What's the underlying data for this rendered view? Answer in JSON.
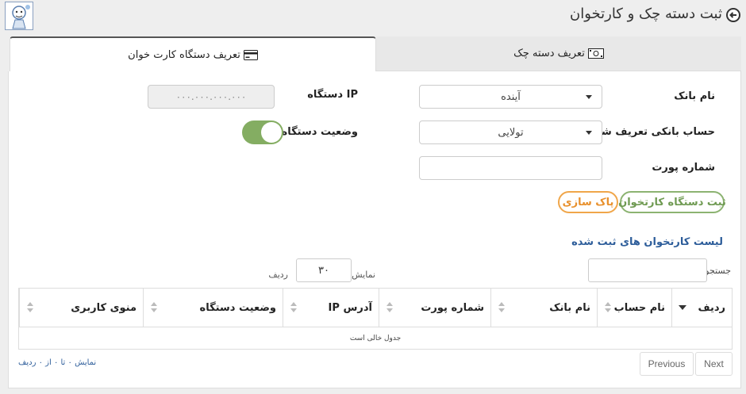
{
  "header": {
    "title": "ثبت دسته چک و کارتخوان"
  },
  "tabs": [
    {
      "label": "تعریف دستگاه کارت خوان",
      "icon": "credit-card-icon",
      "active": true
    },
    {
      "label": "تعریف دسته چک",
      "icon": "money-icon",
      "active": false
    }
  ],
  "form": {
    "bank_label": "نام بانک",
    "bank_value": "آینده",
    "account_label": "حساب بانکی تعریف شده",
    "account_value": "تولایی",
    "port_label": "شماره پورت",
    "port_value": "",
    "ip_label": "IP دستگاه",
    "ip_placeholder": "۰۰۰.۰۰۰.۰۰۰.۰۰۰",
    "status_label": "وضعیت دستگاه",
    "status_on": true
  },
  "buttons": {
    "save": "ثبت دستگاه کارتخوان",
    "clear": "پاک سازی"
  },
  "list": {
    "title": "لیست کارتخوان های ثبت شده",
    "search_label": "جستجو:",
    "show_label": "نمایش",
    "rows_label": "ردیف",
    "page_length": "۳۰",
    "columns": [
      "ردیف",
      "نام حساب",
      "نام بانک",
      "شماره پورت",
      "آدرس IP",
      "وضعیت دستگاه",
      "منوی کاربری"
    ],
    "empty_text": "جدول خالی است",
    "info": "نمایش ۰ تا ۰ از ۰ ردیف",
    "prev": "Previous",
    "next": "Next"
  },
  "colors": {
    "accent_green": "#8cb371",
    "accent_orange": "#f0a64a",
    "link_blue": "#2d5d9a"
  }
}
